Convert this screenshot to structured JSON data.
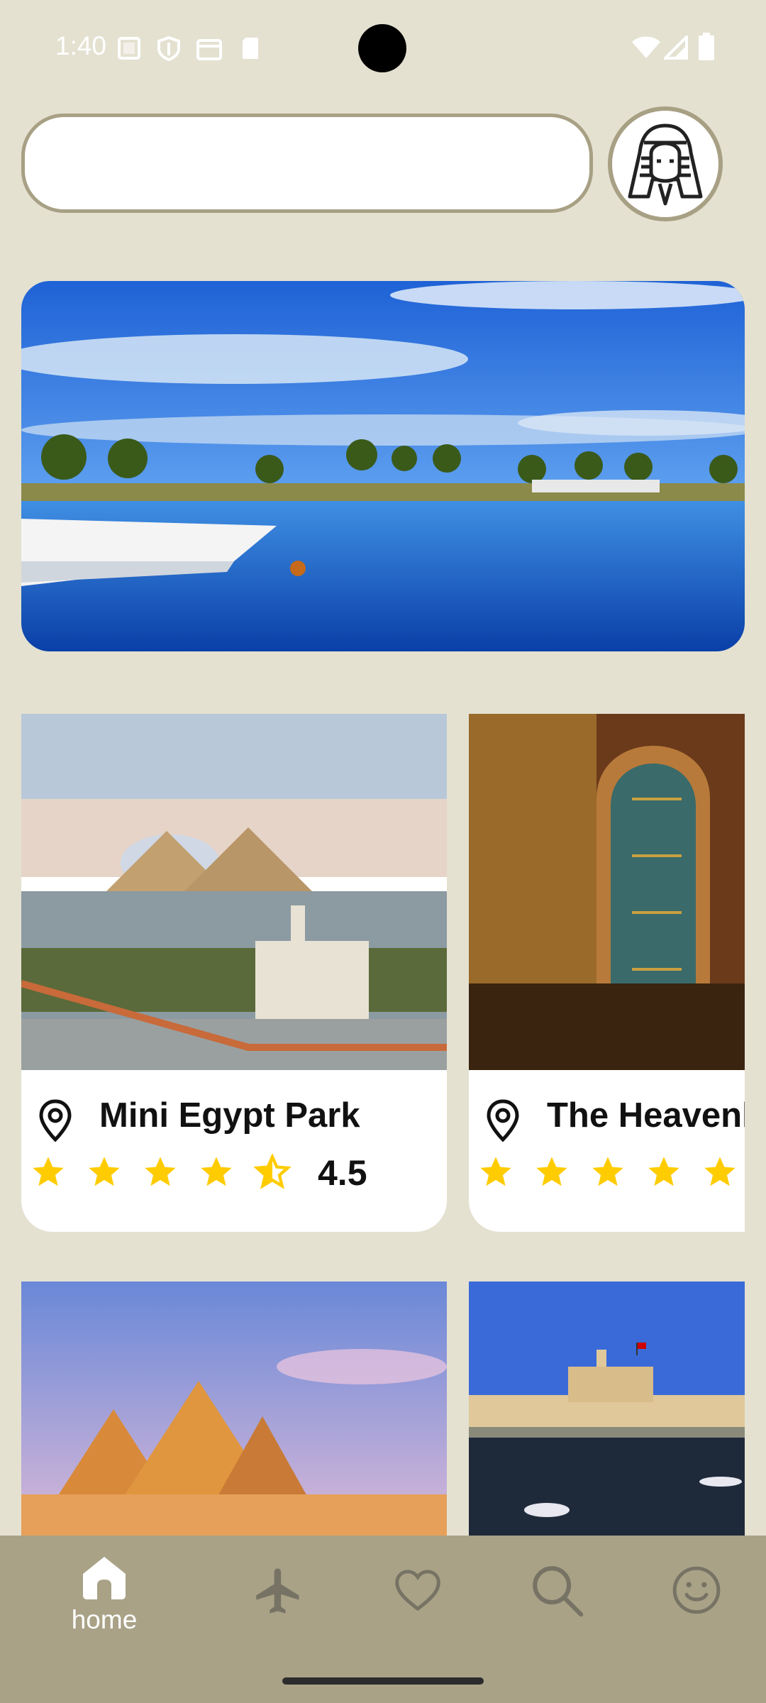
{
  "status_bar": {
    "time": "1:40"
  },
  "search": {
    "value": "",
    "placeholder": ""
  },
  "cards": [
    {
      "title": "Mini Egypt Park",
      "rating": "4.5"
    },
    {
      "title": "The Heavenly Church",
      "rating": ""
    }
  ],
  "nav": {
    "items": [
      {
        "label": "home",
        "icon": "home-icon",
        "active": true
      },
      {
        "label": "",
        "icon": "airplane-icon"
      },
      {
        "label": "",
        "icon": "heart-icon"
      },
      {
        "label": "",
        "icon": "search-icon"
      },
      {
        "label": "",
        "icon": "smiley-icon"
      }
    ]
  },
  "colors": {
    "background": "#e4e1d1",
    "nav_bar": "#a9a287",
    "accent_border": "#a8a084",
    "star": "#ffcc00"
  }
}
